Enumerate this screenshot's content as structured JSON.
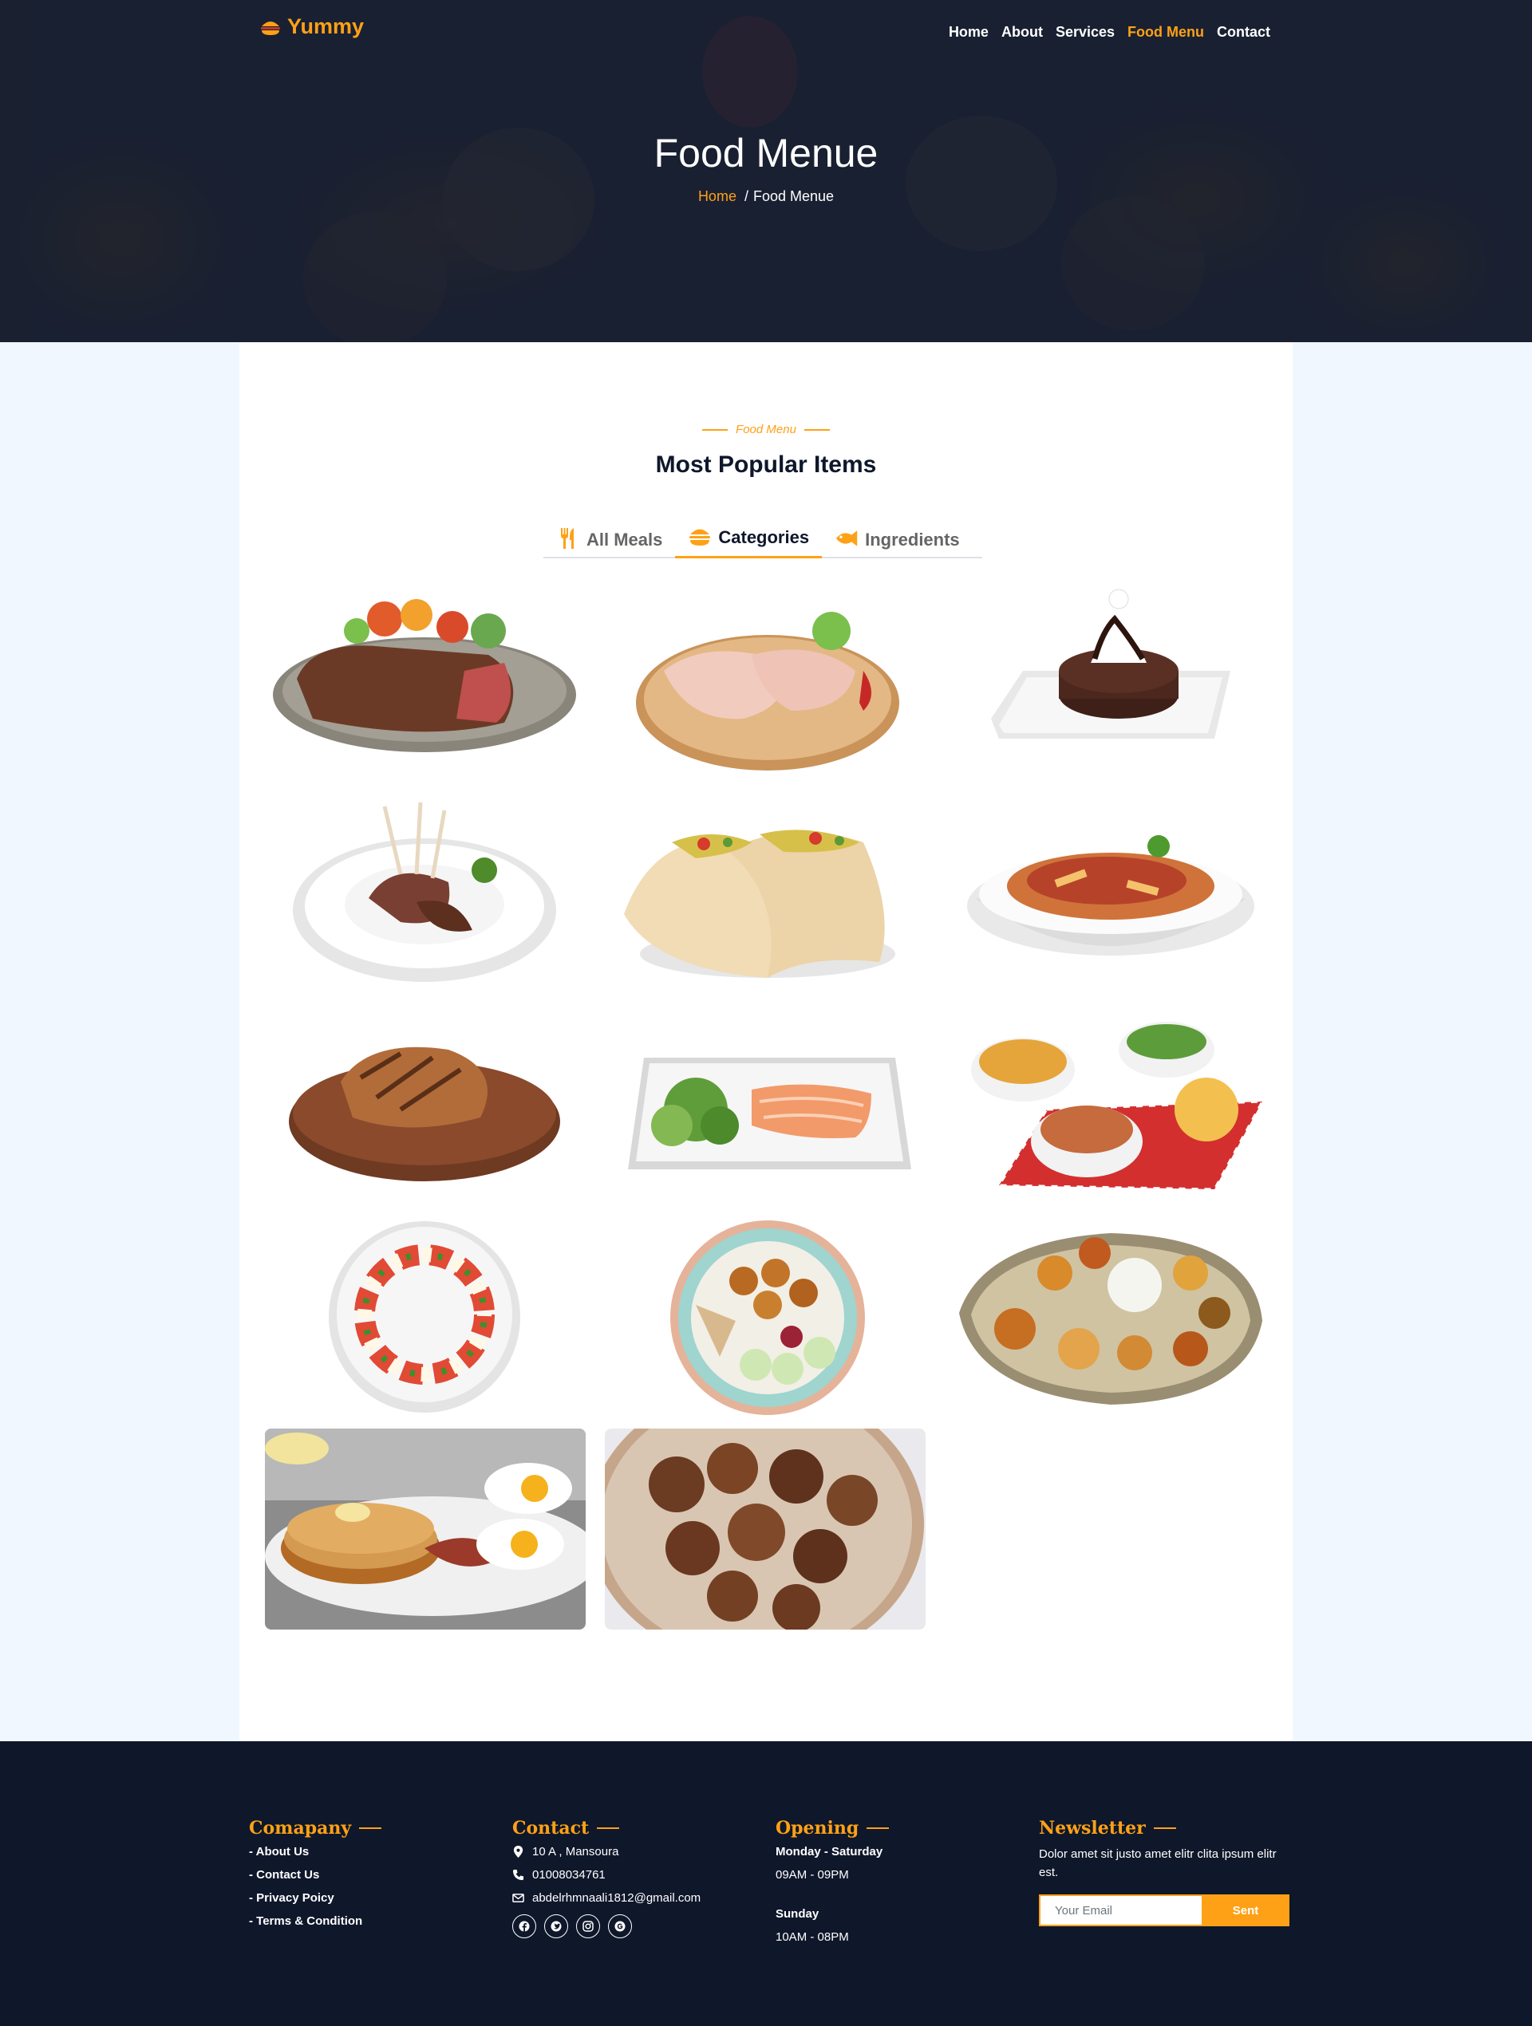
{
  "brand": {
    "name": "Yummy",
    "accent": "#fea116",
    "dark": "#0f172b"
  },
  "nav": {
    "items": [
      {
        "label": "Home",
        "active": false
      },
      {
        "label": "About",
        "active": false
      },
      {
        "label": "Services",
        "active": false
      },
      {
        "label": "Food Menu",
        "active": true
      },
      {
        "label": "Contact",
        "active": false
      }
    ]
  },
  "hero": {
    "title": "Food Menue",
    "breadcrumb": {
      "home": "Home",
      "separator": "/",
      "current": "Food Menue"
    }
  },
  "menu_section": {
    "tag": "Food Menu",
    "title": "Most Popular Items",
    "tabs": [
      {
        "label": "All Meals",
        "icon": "utensils-icon",
        "active": false
      },
      {
        "label": "Categories",
        "icon": "hamburger-icon",
        "active": true
      },
      {
        "label": "Ingredients",
        "icon": "fish-icon",
        "active": false
      }
    ],
    "items": [
      {
        "name": "steak-plate"
      },
      {
        "name": "raw-chicken-board"
      },
      {
        "name": "chocolate-lava-cake"
      },
      {
        "name": "lamb-chops"
      },
      {
        "name": "tacos"
      },
      {
        "name": "penne-pasta"
      },
      {
        "name": "grilled-steak-board"
      },
      {
        "name": "salmon-salad-platter"
      },
      {
        "name": "side-dishes-bowls"
      },
      {
        "name": "caprese-salad"
      },
      {
        "name": "falafel-bowl"
      },
      {
        "name": "thali-platter"
      },
      {
        "name": "pancakes-eggs-bacon"
      },
      {
        "name": "beef-stew-bowl"
      }
    ]
  },
  "footer": {
    "company": {
      "heading": "Comapany",
      "links": [
        "- About Us",
        "- Contact Us",
        "- Privacy Poicy",
        "- Terms & Condition"
      ]
    },
    "contact": {
      "heading": "Contact",
      "address": "10 A , Mansoura",
      "phone": "01008034761",
      "email": "abdelrhmnaali1812@gmail.com",
      "socials": [
        "facebook-icon",
        "twitter-icon",
        "instagram-icon",
        "google-icon"
      ]
    },
    "opening": {
      "heading": "Opening",
      "days1": "Monday - Saturday",
      "hours1": "09AM - 09PM",
      "days2": "Sunday",
      "hours2": "10AM - 08PM"
    },
    "newsletter": {
      "heading": "Newsletter",
      "text": "Dolor amet sit justo amet elitr clita ipsum elitr est.",
      "placeholder": "Your Email",
      "button": "Sent"
    }
  }
}
